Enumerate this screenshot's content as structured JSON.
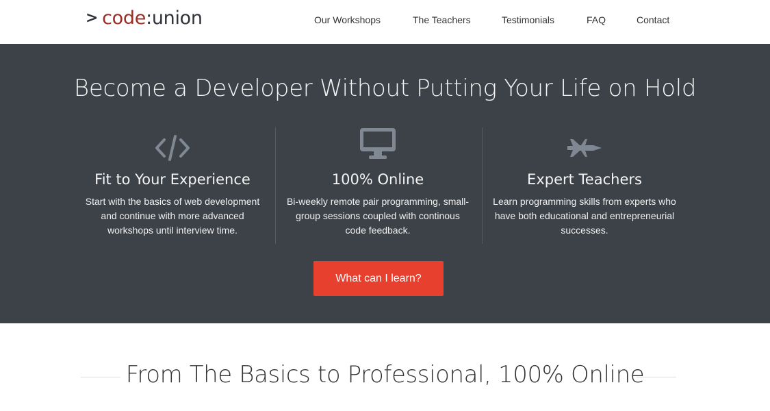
{
  "logo": {
    "prompt": ">",
    "code": "code",
    "colon": ":",
    "union": "union"
  },
  "nav": {
    "items": [
      {
        "label": "Our Workshops"
      },
      {
        "label": "The Teachers"
      },
      {
        "label": "Testimonials"
      },
      {
        "label": "FAQ"
      },
      {
        "label": "Contact"
      }
    ]
  },
  "hero": {
    "title": "Become a Developer Without Putting Your Life on Hold",
    "features": [
      {
        "icon": "code-icon",
        "title": "Fit to Your Experience",
        "text": "Start with the basics of web development and continue with more advanced workshops until interview time."
      },
      {
        "icon": "monitor-icon",
        "title": "100% Online",
        "text": "Bi-weekly remote pair programming, small-group sessions coupled with continous code feedback."
      },
      {
        "icon": "fighter-jet-icon",
        "title": "Expert Teachers",
        "text": "Learn programming skills from experts who have both educational and entrepreneurial successes."
      }
    ],
    "cta_label": "What can I learn?"
  },
  "section": {
    "title": "From The Basics to Professional, 100% Online"
  },
  "colors": {
    "hero_bg": "#3d4249",
    "accent": "#e8402f",
    "logo_code": "#9c2b26",
    "icon": "#7f8893"
  }
}
